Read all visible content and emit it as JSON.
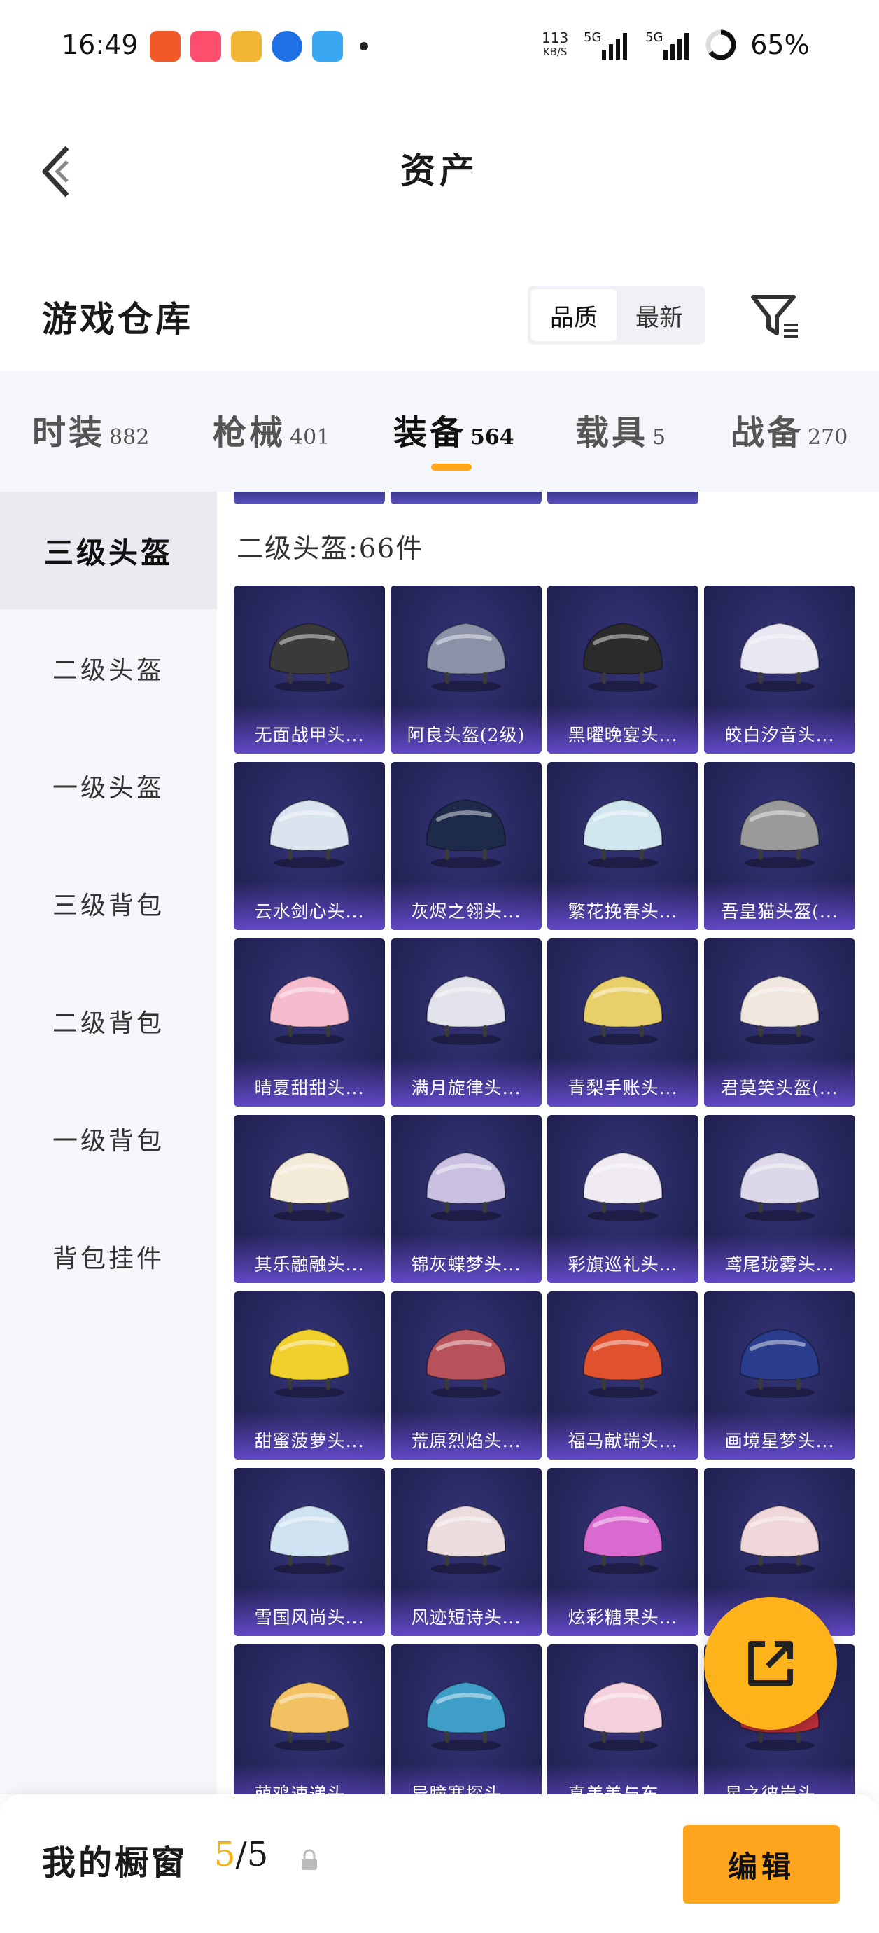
{
  "status_bar": {
    "time": "16:49",
    "speed_value": "113",
    "speed_unit": "KB/S",
    "network_1": "5G",
    "network_2": "5G",
    "battery": "65%"
  },
  "header": {
    "title": "资产",
    "back_icon": "chevron-left-icon"
  },
  "warehouse": {
    "title": "游戏仓库",
    "sort_options": [
      "品质",
      "最新"
    ],
    "sort_active": "品质",
    "filter_icon": "filter-icon"
  },
  "tabs": [
    {
      "label": "时装",
      "count": "882"
    },
    {
      "label": "枪械",
      "count": "401"
    },
    {
      "label": "装备",
      "count": "564"
    },
    {
      "label": "载具",
      "count": "5"
    },
    {
      "label": "战备",
      "count": "270"
    }
  ],
  "active_tab": "装备",
  "sidebar": {
    "items": [
      {
        "label": "三级头盔"
      },
      {
        "label": "二级头盔"
      },
      {
        "label": "一级头盔"
      },
      {
        "label": "三级背包"
      },
      {
        "label": "二级背包"
      },
      {
        "label": "一级背包"
      },
      {
        "label": "背包挂件"
      }
    ],
    "active": "三级头盔"
  },
  "section": {
    "label": "二级头盔:66件"
  },
  "items": [
    {
      "name": "无面战甲头...",
      "color": "#3a3a3a"
    },
    {
      "name": "阿良头盔(2级)",
      "color": "#8a92a8"
    },
    {
      "name": "黑曜晚宴头...",
      "color": "#2b2b2b"
    },
    {
      "name": "皎白汐音头...",
      "color": "#e8e6f0"
    },
    {
      "name": "云水剑心头...",
      "color": "#d9e4ee"
    },
    {
      "name": "灰烬之翎头...",
      "color": "#1e2a4a"
    },
    {
      "name": "繁花挽春头...",
      "color": "#cfe6ee"
    },
    {
      "name": "吾皇猫头盔(...",
      "color": "#9a9a9a"
    },
    {
      "name": "晴夏甜甜头...",
      "color": "#f4bccd"
    },
    {
      "name": "满月旋律头...",
      "color": "#e2e2ea"
    },
    {
      "name": "青梨手账头...",
      "color": "#e9cf6a"
    },
    {
      "name": "君莫笑头盔(...",
      "color": "#efe6de"
    },
    {
      "name": "其乐融融头...",
      "color": "#f3ead8"
    },
    {
      "name": "锦灰蝶梦头...",
      "color": "#c9bfe0"
    },
    {
      "name": "彩旗巡礼头...",
      "color": "#efeaf2"
    },
    {
      "name": "鸢尾珑雾头...",
      "color": "#dcd8ea"
    },
    {
      "name": "甜蜜菠萝头...",
      "color": "#f1cf2c"
    },
    {
      "name": "荒原烈焰头...",
      "color": "#b8525a"
    },
    {
      "name": "福马献瑞头...",
      "color": "#e0512e"
    },
    {
      "name": "画境星梦头...",
      "color": "#2a3c8c"
    },
    {
      "name": "雪国风尚头...",
      "color": "#cfe2f2"
    },
    {
      "name": "风迹短诗头...",
      "color": "#ecdcde"
    },
    {
      "name": "炫彩糖果头...",
      "color": "#d96bd0"
    },
    {
      "name": "",
      "color": "#efd6d8"
    },
    {
      "name": "萌鸡速递头...",
      "color": "#f2c262"
    },
    {
      "name": "异瞳寒探头...",
      "color": "#3f9ec8"
    },
    {
      "name": "真美美与东...",
      "color": "#f4d0dc"
    },
    {
      "name": "星之彼岸头...",
      "color": "#c0303a"
    }
  ],
  "fab": {
    "icon": "share-out-icon"
  },
  "bottom": {
    "title": "我的橱窗",
    "current": "5",
    "separator": "/",
    "total": "5",
    "lock_icon": "lock-icon",
    "edit_label": "编辑"
  }
}
